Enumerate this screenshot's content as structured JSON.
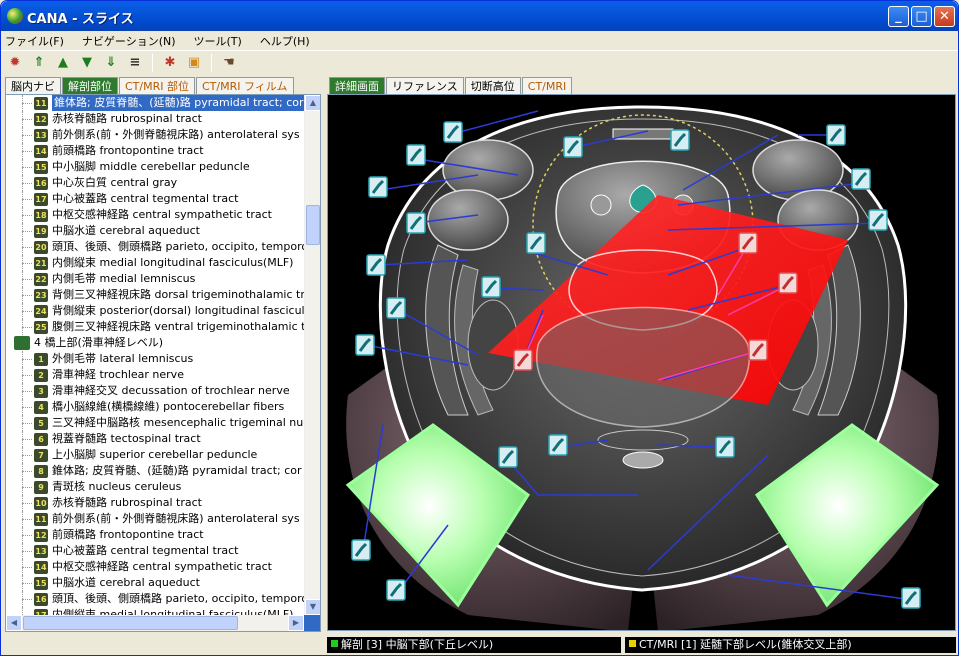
{
  "window": {
    "title": "CANA - スライス",
    "buttons": {
      "minimize": "_",
      "maximize": "□",
      "close": "✕"
    }
  },
  "menu": [
    "ファイル(F)",
    "ナビゲーション(N)",
    "ツール(T)",
    "ヘルプ(H)"
  ],
  "toolbar": [
    {
      "icon": "settings-sun-icon",
      "glyph": "✹",
      "color": "#c0392b"
    },
    {
      "icon": "top-arrow-icon",
      "glyph": "⇑",
      "color": "#1e7d1e"
    },
    {
      "icon": "up-arrow-icon",
      "glyph": "▲",
      "color": "#1e7d1e"
    },
    {
      "icon": "down-arrow-icon",
      "glyph": "▼",
      "color": "#1e7d1e"
    },
    {
      "icon": "bottom-arrow-icon",
      "glyph": "⇓",
      "color": "#1e7d1e"
    },
    {
      "icon": "layers-icon",
      "glyph": "≡",
      "color": "#333333"
    },
    {
      "icon": "target-icon",
      "glyph": "✱",
      "color": "#c0392b"
    },
    {
      "icon": "image-icon",
      "glyph": "▣",
      "color": "#d48a1a"
    },
    {
      "icon": "hand-icon",
      "glyph": "☚",
      "color": "#6b4a2a"
    }
  ],
  "left_tabs": [
    {
      "label": "脳内ナビ",
      "state": "plain"
    },
    {
      "label": "解剖部位",
      "state": "active"
    },
    {
      "label": "CT/MRI 部位",
      "state": "normal"
    },
    {
      "label": "CT/MRI フィルム",
      "state": "normal"
    }
  ],
  "right_tabs": [
    {
      "label": "詳細画面",
      "state": "active"
    },
    {
      "label": "リファレンス",
      "state": "plain"
    },
    {
      "label": "切断高位",
      "state": "plain"
    },
    {
      "label": "CT/MRI",
      "state": "normal"
    }
  ],
  "tree": [
    {
      "num": "11",
      "label": "錐体路; 皮質脊髄、(延髄)路  pyramidal tract; cor",
      "selected": true
    },
    {
      "num": "12",
      "label": "赤核脊髄路  rubrospinal tract"
    },
    {
      "num": "13",
      "label": "前外側系(前・外側脊髄視床路)  anterolateral sys"
    },
    {
      "num": "14",
      "label": "前頭橋路  frontopontine tract"
    },
    {
      "num": "15",
      "label": "中小脳脚  middle cerebellar peduncle"
    },
    {
      "num": "16",
      "label": "中心灰白質  central gray"
    },
    {
      "num": "17",
      "label": "中心被蓋路  central tegmental tract"
    },
    {
      "num": "18",
      "label": "中枢交感神経路  central sympathetic tract"
    },
    {
      "num": "19",
      "label": "中脳水道  cerebral aqueduct"
    },
    {
      "num": "20",
      "label": "頭頂、後頭、側頭橋路  parieto, occipito, temporop"
    },
    {
      "num": "21",
      "label": "内側縦束  medial longitudinal fasciculus(MLF)"
    },
    {
      "num": "22",
      "label": "内側毛帯  medial lemniscus"
    },
    {
      "num": "23",
      "label": "背側三叉神経視床路  dorsal trigeminothalamic tr"
    },
    {
      "num": "24",
      "label": "背側縦束  posterior(dorsal) longitudinal fasciculu"
    },
    {
      "num": "25",
      "label": "腹側三叉神経視床路  ventral trigeminothalamic t"
    },
    {
      "group": true,
      "label": "4 橋上部(滑車神経レベル)"
    },
    {
      "num": "1",
      "label": "外側毛帯  lateral lemniscus"
    },
    {
      "num": "2",
      "label": "滑車神経  trochlear nerve"
    },
    {
      "num": "3",
      "label": "滑車神経交叉  decussation of trochlear nerve"
    },
    {
      "num": "4",
      "label": "橋小脳線維(横橋線維)  pontocerebellar fibers"
    },
    {
      "num": "5",
      "label": "三叉神経中脳路核  mesencephalic trigeminal nuc"
    },
    {
      "num": "6",
      "label": "視蓋脊髄路  tectospinal tract"
    },
    {
      "num": "7",
      "label": "上小脳脚  superior cerebellar peduncle"
    },
    {
      "num": "8",
      "label": "錐体路; 皮質脊髄、(延髄)路  pyramidal tract; cor"
    },
    {
      "num": "9",
      "label": "青斑核  nucleus ceruleus"
    },
    {
      "num": "10",
      "label": "赤核脊髄路  rubrospinal tract"
    },
    {
      "num": "11",
      "label": "前外側系(前・外側脊髄視床路)  anterolateral sys"
    },
    {
      "num": "12",
      "label": "前頭橋路  frontopontine tract"
    },
    {
      "num": "13",
      "label": "中心被蓋路  central tegmental tract"
    },
    {
      "num": "14",
      "label": "中枢交感神経路  central sympathetic tract"
    },
    {
      "num": "15",
      "label": "中脳水道  cerebral aqueduct"
    },
    {
      "num": "16",
      "label": "頭頂、後頭、側頭橋路  parieto, occipito, temporop"
    },
    {
      "num": "17",
      "label": "内側縦束  medial longitudinal fasciculus(MLF)"
    }
  ],
  "status": {
    "left": "解剖 [3] 中脳下部(下丘レベル)",
    "left_color": "#22cc22",
    "right": "CT/MRI [1] 延髄下部レベル(錐体交叉上部)",
    "right_color": "#e6d200"
  },
  "colors": {
    "accent_green": "#2f7a2f",
    "highlight_red": "#ff2020",
    "highlight_green": "#7cff7c",
    "leader_line": "#2b3bd6"
  }
}
